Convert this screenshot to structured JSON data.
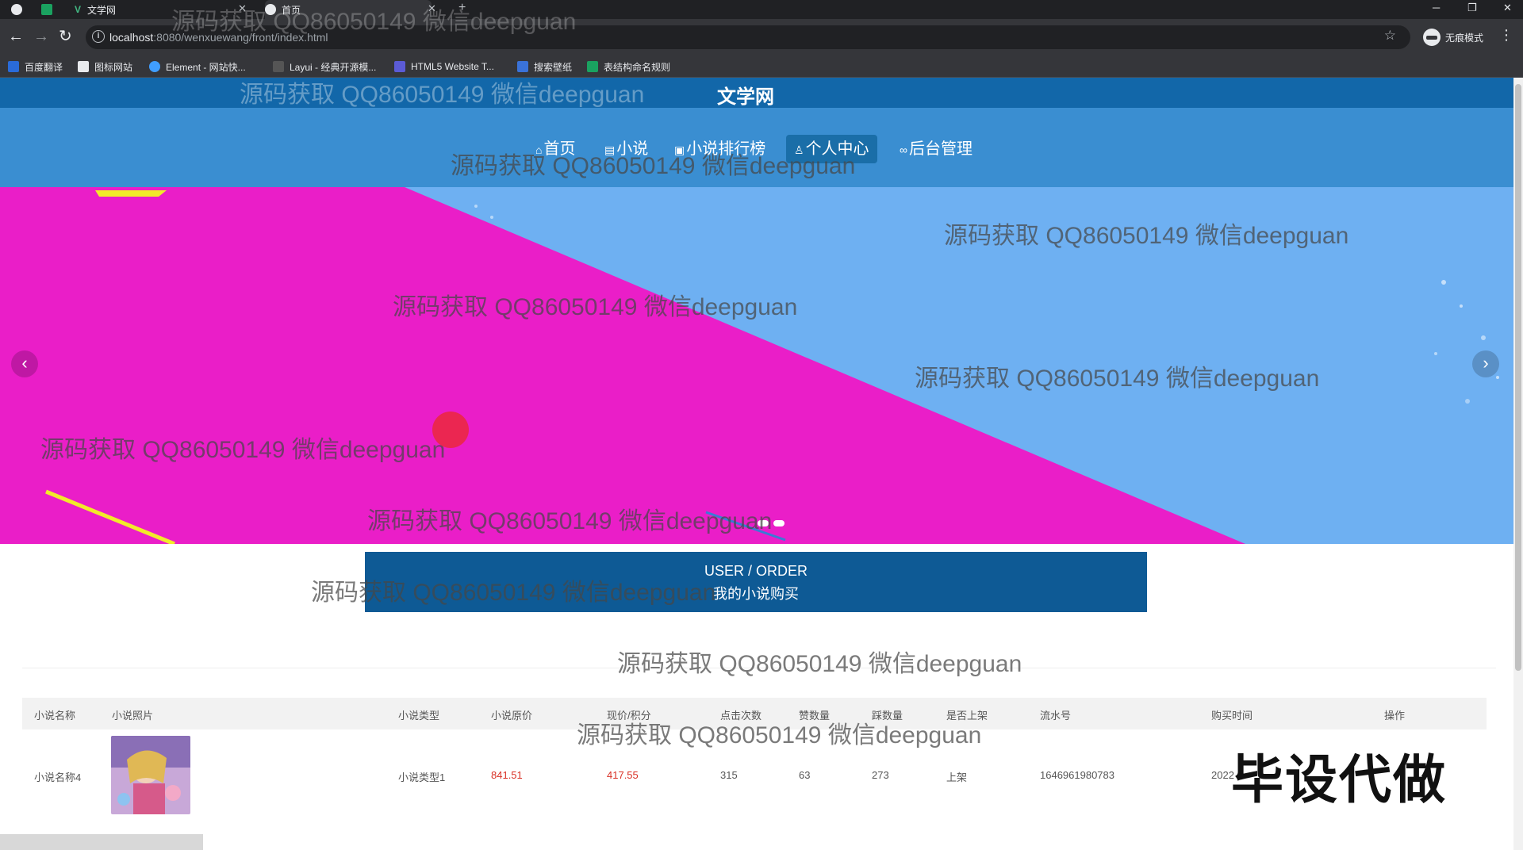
{
  "browser": {
    "tabs": [
      {
        "title": "文学网",
        "icon": "v-logo-icon"
      },
      {
        "title": "首页",
        "icon": "globe-icon"
      }
    ],
    "new_tab": "+",
    "url_host": "localhost",
    "url_path": ":8080/wenxuewang/front/index.html",
    "incognito_label": "无痕模式",
    "bookmarks": [
      "百度翻译",
      "图标网站",
      "Element - 网站快...",
      "Layui - 经典开源模...",
      "HTML5 Website T...",
      "搜索壁纸",
      "表结构命名规则"
    ]
  },
  "site": {
    "title": "文学网",
    "nav": [
      {
        "label": "首页",
        "icon": "home-icon"
      },
      {
        "label": "小说",
        "icon": "book-icon"
      },
      {
        "label": "小说排行榜",
        "icon": "gift-icon"
      },
      {
        "label": "个人中心",
        "icon": "user-icon",
        "active": true
      },
      {
        "label": "后台管理",
        "icon": "link-icon"
      }
    ]
  },
  "section": {
    "title_en": "USER / ORDER",
    "title_cn": "我的小说购买"
  },
  "table": {
    "headers": [
      "小说名称",
      "小说照片",
      "小说类型",
      "小说原价",
      "现价/积分",
      "点击次数",
      "赞数量",
      "踩数量",
      "是否上架",
      "流水号",
      "购买时间",
      "操作"
    ],
    "rows": [
      {
        "name": "小说名称4",
        "type": "小说类型1",
        "original_price": "841.51",
        "current_price": "417.55",
        "clicks": "315",
        "likes": "63",
        "dislikes": "273",
        "on_shelf": "上架",
        "serial": "1646961980783",
        "purchase_time": "2022"
      }
    ]
  },
  "overlays": {
    "watermark": "源码获取 QQ86050149 微信deepguan",
    "stamp": "毕设代做"
  },
  "colors": {
    "header_blue": "#1267a9",
    "nav_blue": "#3a8ed1",
    "section_blue": "#0e5a95",
    "banner_magenta": "#ea1ec8",
    "banner_sky": "#6eb0f2",
    "price_red": "#d93025"
  }
}
